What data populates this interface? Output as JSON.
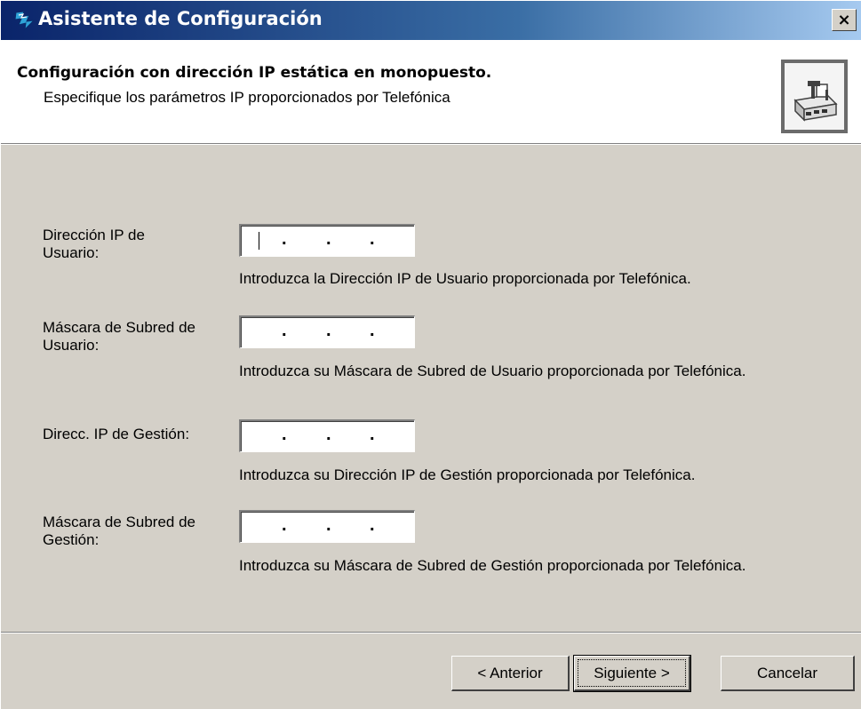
{
  "window": {
    "title": "Asistente de Configuración",
    "close_label": "×"
  },
  "header": {
    "title": "Configuración con dirección IP estática en monopuesto.",
    "subtitle": "Especifique los parámetros IP proporcionados por Telefónica",
    "icon": "network-device-icon"
  },
  "fields": [
    {
      "label": "Dirección IP de Usuario:",
      "value": ". . .",
      "hint": "Introduzca la Dirección IP de Usuario proporcionada por Telefónica."
    },
    {
      "label": "Máscara de Subred de Usuario:",
      "value": ". . .",
      "hint": "Introduzca su Máscara de Subred de Usuario proporcionada por Telefónica."
    },
    {
      "label": "Direcc. IP de Gestión:",
      "value": ". . .",
      "hint": "Introduzca su Dirección IP de Gestión proporcionada por Telefónica."
    },
    {
      "label": "Máscara de Subred de Gestión:",
      "value": ". . .",
      "hint": "Introduzca su Máscara de Subred de Gestión proporcionada por Telefónica."
    }
  ],
  "buttons": {
    "back": "< Anterior",
    "next": "Siguiente >",
    "cancel": "Cancelar"
  }
}
